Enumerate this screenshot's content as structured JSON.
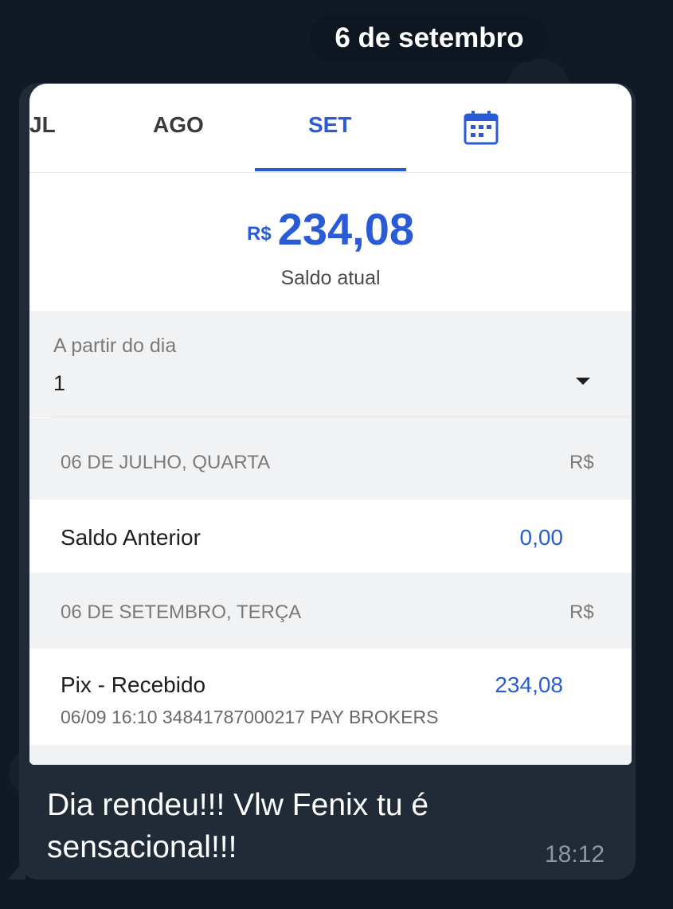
{
  "chat": {
    "date_separator": "6 de setembro",
    "message_text": "Dia rendeu!!! Vlw Fenix tu é sensacional!!!",
    "message_time": "18:12"
  },
  "screenshot": {
    "tabs": [
      {
        "label": "JL"
      },
      {
        "label": "AGO"
      },
      {
        "label": "SET",
        "active": true
      }
    ],
    "calendar_icon": "calendar-icon",
    "balance": {
      "currency": "R$",
      "amount": "234,08",
      "label": "Saldo atual"
    },
    "filter": {
      "label": "A partir do dia",
      "value": "1"
    },
    "groups": [
      {
        "date": "06 DE JULHO, QUARTA",
        "currency": "R$",
        "entries": [
          {
            "title": "Saldo Anterior",
            "value": "0,00"
          }
        ]
      },
      {
        "date": "06 DE SETEMBRO, TERÇA",
        "currency": "R$",
        "entries": [
          {
            "title": "Pix - Recebido",
            "value": "234,08",
            "detail": "06/09 16:10 34841787000217 PAY BROKERS"
          }
        ]
      }
    ],
    "colors": {
      "accent": "#2a5bd7",
      "bubble": "#212b38",
      "background": "#0e1621"
    }
  }
}
